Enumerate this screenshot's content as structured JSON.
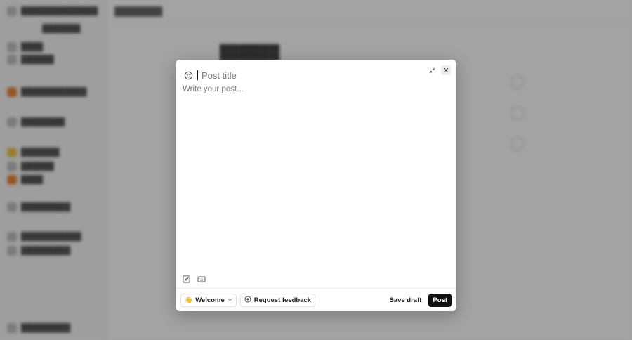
{
  "modal": {
    "title_placeholder": "Post title",
    "body_placeholder": "Write your post...",
    "footer": {
      "space": {
        "emoji": "👋",
        "label": "Welcome"
      },
      "feedback_label": "Request feedback",
      "save_draft_label": "Save draft",
      "post_label": "Post"
    }
  },
  "icons": {
    "emoji": "smiley-icon",
    "collapse": "collapse-icon",
    "close": "close-icon",
    "edit": "edit-icon",
    "keyboard": "keyboard-icon",
    "add": "plus-circle-icon",
    "chevron": "chevron-down-icon"
  },
  "colors": {
    "post_button": "#111111",
    "overlay": "rgba(0,0,0,0.35)"
  }
}
